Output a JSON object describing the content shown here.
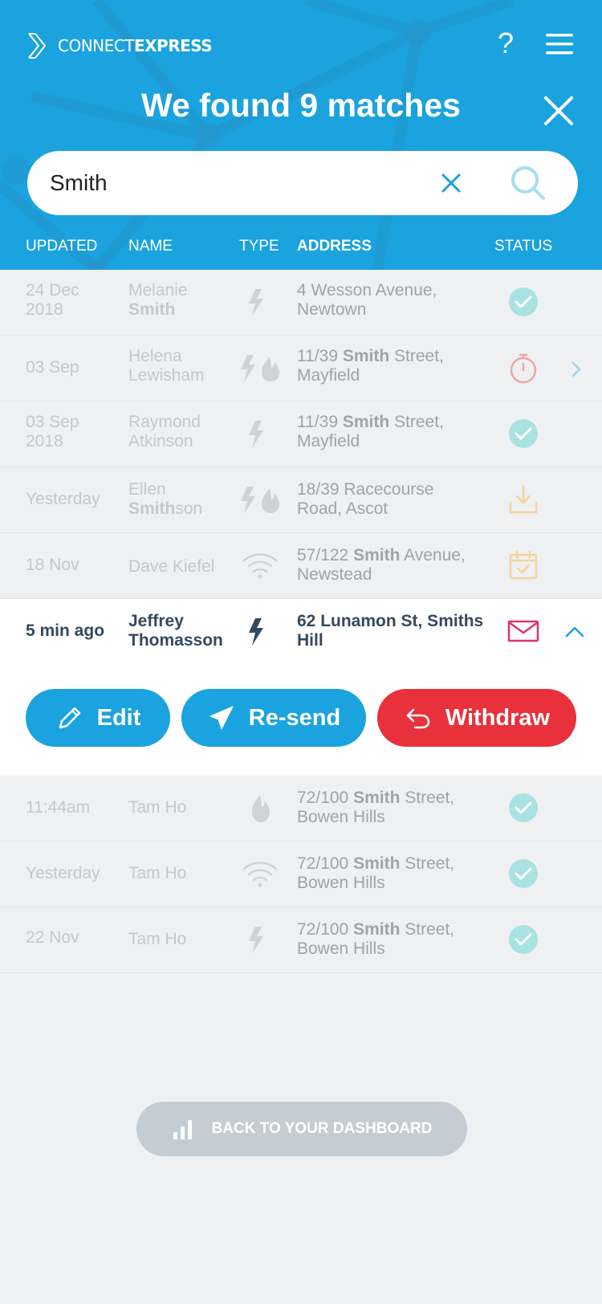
{
  "app": {
    "logo_light": "CONNECT",
    "logo_bold": "EXPRESS",
    "help_label": "?",
    "title": "We found 9 matches"
  },
  "search": {
    "value": "Smith",
    "placeholder": ""
  },
  "columns": {
    "updated": "UPDATED",
    "name": "NAME",
    "type": "TYPE",
    "address": "ADDRESS",
    "status": "STATUS"
  },
  "rows": [
    {
      "updated": [
        "24 Dec",
        "2018"
      ],
      "first": "Melanie",
      "last_pre": "",
      "last_hl": "Smith",
      "last_post": "",
      "types": [
        "bolt"
      ],
      "addr_pre": "4 Wesson Avenue,",
      "addr_hl": "",
      "addr_post": "",
      "addr_line2": "Newtown",
      "status": "check-icon"
    },
    {
      "updated": [
        "03 Sep"
      ],
      "first": "Helena",
      "last_pre": "Lewisham",
      "last_hl": "",
      "last_post": "",
      "types": [
        "bolt",
        "flame"
      ],
      "addr_pre": "11/39 ",
      "addr_hl": "Smith",
      "addr_post": " Street,",
      "addr_line2": "Mayfield",
      "status": "stopwatch-icon"
    },
    {
      "updated": [
        "03 Sep",
        "2018"
      ],
      "first": "Raymond",
      "last_pre": "Atkinson",
      "last_hl": "",
      "last_post": "",
      "types": [
        "bolt"
      ],
      "addr_pre": "11/39 ",
      "addr_hl": "Smith",
      "addr_post": " Street,",
      "addr_line2": "Mayfield",
      "status": "check-icon"
    },
    {
      "updated": [
        "Yesterday"
      ],
      "first": "Ellen",
      "last_pre": "",
      "last_hl": "Smith",
      "last_post": "son",
      "types": [
        "bolt",
        "flame"
      ],
      "addr_pre": "18/39 Racecourse",
      "addr_hl": "",
      "addr_post": "",
      "addr_line2": "Road, Ascot",
      "status": "download-icon"
    },
    {
      "updated": [
        "18 Nov"
      ],
      "first": "Dave Kiefel",
      "last_pre": "",
      "last_hl": "",
      "last_post": "",
      "types": [
        "wifi"
      ],
      "addr_pre": "57/122 ",
      "addr_hl": "Smith",
      "addr_post": " Avenue,",
      "addr_line2": "Newstead",
      "status": "calendar-check-icon"
    }
  ],
  "expanded": {
    "updated": "5 min ago",
    "first": "Jeffrey",
    "last": "Thomasson",
    "address_line1": "62 Lunamon St, Smiths",
    "address_line2": "Hill",
    "edit": "Edit",
    "resend": "Re-send",
    "withdraw": "Withdraw"
  },
  "rows_after": [
    {
      "updated": "11:44am",
      "name": "Tam Ho",
      "type": "flame",
      "addr_pre": "72/100 ",
      "addr_hl": "Smith",
      "addr_post": " Street,",
      "addr_line2": "Bowen Hills"
    },
    {
      "updated": "Yesterday",
      "name": "Tam Ho",
      "type": "wifi",
      "addr_pre": "72/100 ",
      "addr_hl": "Smith",
      "addr_post": " Street,",
      "addr_line2": "Bowen Hills"
    },
    {
      "updated": "22 Nov",
      "name": "Tam Ho",
      "type": "bolt",
      "addr_pre": "72/100 ",
      "addr_hl": "Smith",
      "addr_post": " Street,",
      "addr_line2": "Bowen Hills"
    }
  ],
  "dashboard_button": "BACK TO YOUR DASHBOARD",
  "colors": {
    "primary": "#1aa3de",
    "danger": "#e8313b",
    "teal_check": "#a9e3e1",
    "mail_pink": "#e0336e",
    "text_dark": "#34495e"
  }
}
